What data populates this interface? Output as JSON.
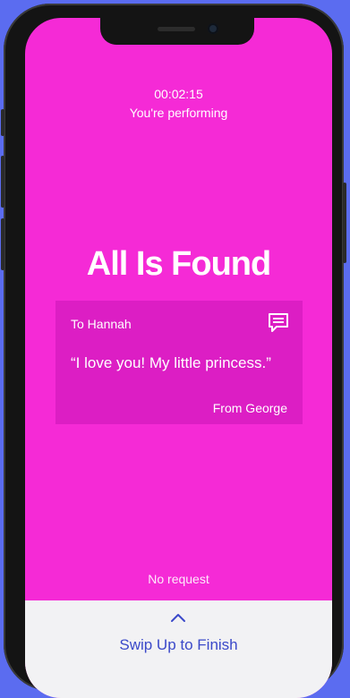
{
  "status": {
    "timer": "00:02:15",
    "subtitle": "You're performing"
  },
  "song": {
    "title": "All Is Found"
  },
  "dedication": {
    "to": "To Hannah",
    "message": "“I love you! My little princess.”",
    "from": "From George",
    "icon": "message-icon"
  },
  "request": {
    "text": "No request"
  },
  "footer": {
    "swipe_label": "Swip Up to Finish",
    "icon": "chevron-up-icon"
  },
  "colors": {
    "background": "#5b6cf0",
    "screen": "#f52ad6",
    "card": "#dc1ec4",
    "footer_text": "#3b49c9"
  }
}
